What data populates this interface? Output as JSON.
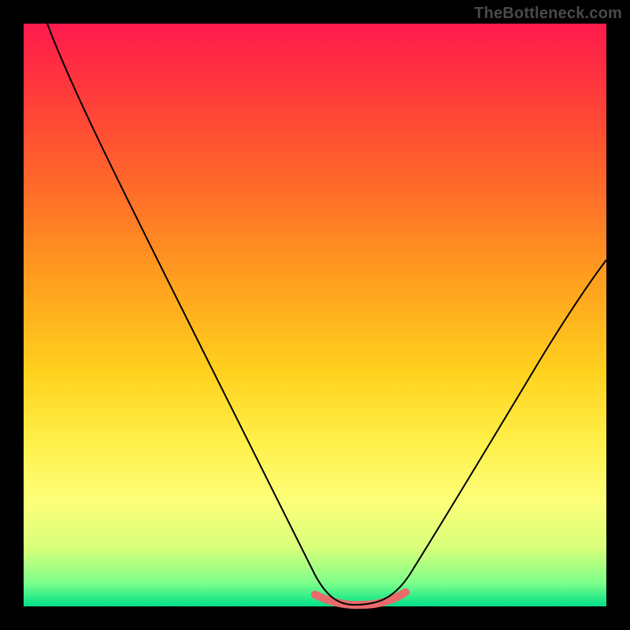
{
  "watermark": "TheBottleneck.com",
  "chart_data": {
    "type": "line",
    "title": "",
    "xlabel": "",
    "ylabel": "",
    "xlim": [
      0,
      100
    ],
    "ylim": [
      0,
      100
    ],
    "grid": false,
    "legend": false,
    "x": [
      0,
      6,
      12,
      18,
      24,
      30,
      36,
      42,
      48,
      51,
      54,
      57,
      60,
      63,
      66,
      72,
      78,
      84,
      90,
      96,
      100
    ],
    "series": [
      {
        "name": "bottleneck-curve",
        "values": [
          100,
          89,
          78,
          67,
          56,
          45,
          34,
          23,
          10,
          3,
          0.5,
          0,
          0,
          0.5,
          3,
          12,
          22,
          32,
          42,
          52,
          59
        ]
      }
    ],
    "annotations": [
      {
        "name": "trough-highlight",
        "x_range": [
          50,
          65
        ],
        "y_approx": 0.5,
        "color": "#e86a6a"
      }
    ],
    "background_gradient": {
      "top": "#ff1a4d",
      "bottom": "#00e08a"
    }
  }
}
